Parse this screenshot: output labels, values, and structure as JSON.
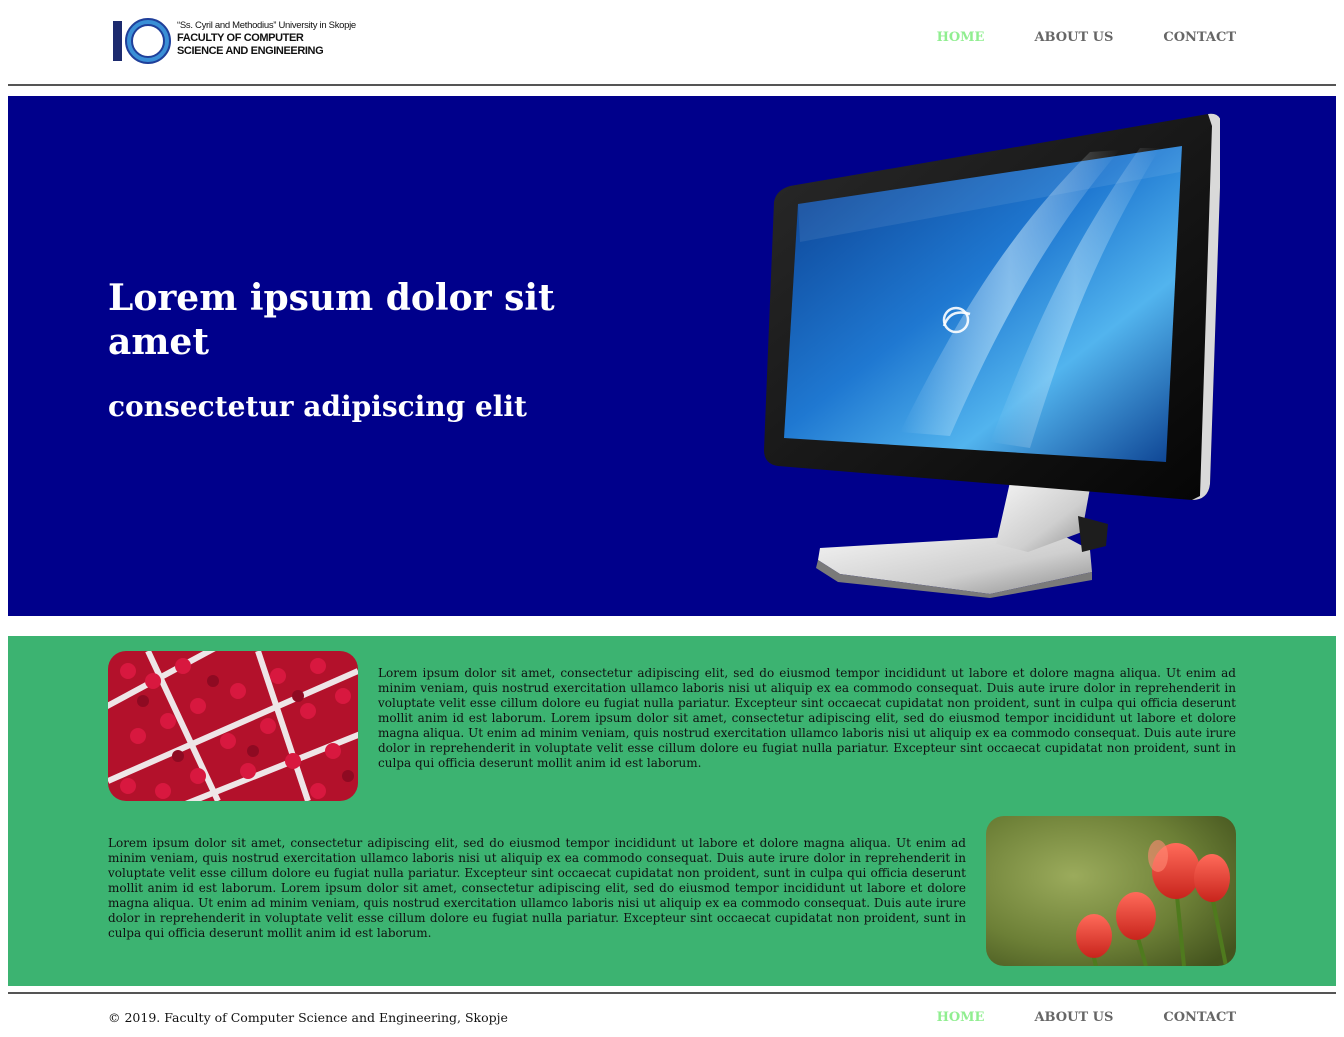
{
  "header": {
    "logo": {
      "mark": "IO",
      "line1": "“Ss. Cyril and Methodius” University in Skopje",
      "line2": "FACULTY OF COMPUTER",
      "line3": "SCIENCE AND ENGINEERING"
    },
    "nav": [
      {
        "label": "HOME",
        "active": true
      },
      {
        "label": "ABOUT US",
        "active": false
      },
      {
        "label": "CONTACT",
        "active": false
      }
    ]
  },
  "hero": {
    "title": "Lorem ipsum dolor sit amet",
    "subtitle": "consectetur adipiscing elit",
    "background": "#00008b",
    "image": "computer-monitor-image"
  },
  "content": {
    "background": "#3cb371",
    "sections": [
      {
        "image": "raspberries-image",
        "text": "Lorem ipsum dolor sit amet, consectetur adipiscing elit, sed do eiusmod tempor incididunt ut labore et dolore magna aliqua. Ut enim ad minim veniam, quis nostrud exercitation ullamco laboris nisi ut aliquip ex ea commodo consequat. Duis aute irure dolor in reprehenderit in voluptate velit esse cillum dolore eu fugiat nulla pariatur. Excepteur sint occaecat cupidatat non proident, sunt in culpa qui officia deserunt mollit anim id est laborum. Lorem ipsum dolor sit amet, consectetur adipiscing elit, sed do eiusmod tempor incididunt ut labore et dolore magna aliqua. Ut enim ad minim veniam, quis nostrud exercitation ullamco laboris nisi ut aliquip ex ea commodo consequat. Duis aute irure dolor in reprehenderit in voluptate velit esse cillum dolore eu fugiat nulla pariatur. Excepteur sint occaecat cupidatat non proident, sunt in culpa qui officia deserunt mollit anim id est laborum."
      },
      {
        "image": "tulips-image",
        "text": "Lorem ipsum dolor sit amet, consectetur adipiscing elit, sed do eiusmod tempor incididunt ut labore et dolore magna aliqua. Ut enim ad minim veniam, quis nostrud exercitation ullamco laboris nisi ut aliquip ex ea commodo consequat. Duis aute irure dolor in reprehenderit in voluptate velit esse cillum dolore eu fugiat nulla pariatur. Excepteur sint occaecat cupidatat non proident, sunt in culpa qui officia deserunt mollit anim id est laborum. Lorem ipsum dolor sit amet, consectetur adipiscing elit, sed do eiusmod tempor incididunt ut labore et dolore magna aliqua. Ut enim ad minim veniam, quis nostrud exercitation ullamco laboris nisi ut aliquip ex ea commodo consequat. Duis aute irure dolor in reprehenderit in voluptate velit esse cillum dolore eu fugiat nulla pariatur. Excepteur sint occaecat cupidatat non proident, sunt in culpa qui officia deserunt mollit anim id est laborum."
      }
    ]
  },
  "footer": {
    "copyright": "© 2019. Faculty of Computer Science and Engineering, Skopje",
    "nav": [
      {
        "label": "HOME",
        "active": true
      },
      {
        "label": "ABOUT US",
        "active": false
      },
      {
        "label": "CONTACT",
        "active": false
      }
    ]
  },
  "colors": {
    "nav_active": "#90ee90",
    "nav_inactive": "#666666",
    "hero_bg": "#00008b",
    "content_bg": "#3cb371"
  }
}
